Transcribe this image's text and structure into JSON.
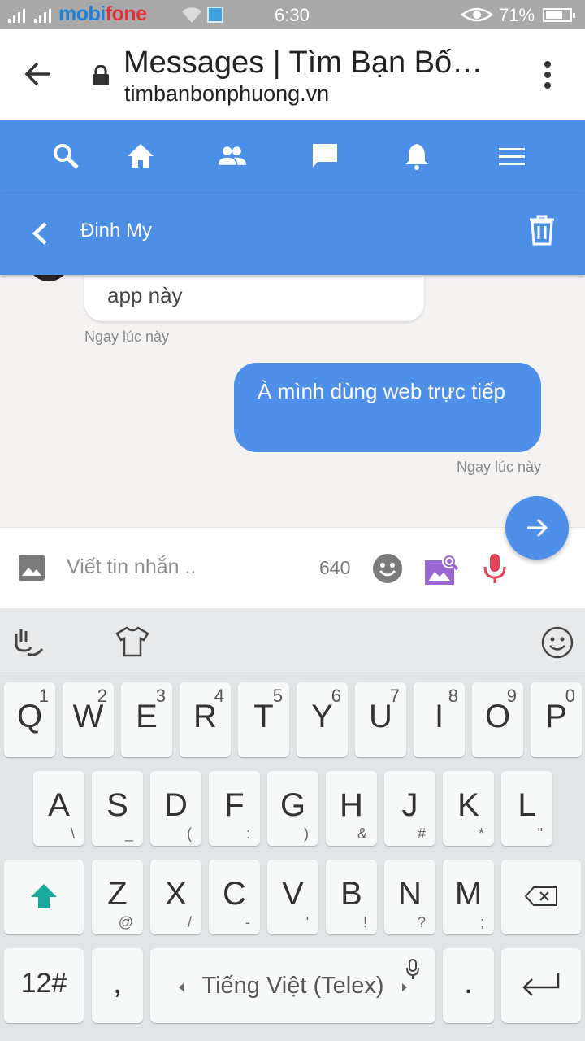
{
  "status_bar": {
    "carrier_part1": "mobi",
    "carrier_part2": "fone",
    "time": "6:30",
    "battery_percent": "71%",
    "battery_level": 0.71,
    "icons": [
      "signal-icon",
      "signal-icon",
      "wifi-icon",
      "message-notification-icon",
      "eye-icon",
      "battery-icon"
    ]
  },
  "browser": {
    "page_title": "Messages | Tìm Bạn Bốn Phương",
    "url": "timbanbonphuong.vn",
    "icons": [
      "back-arrow-icon",
      "lock-icon",
      "overflow-menu-icon"
    ]
  },
  "site_nav": {
    "items": [
      "search-icon",
      "home-icon",
      "friends-icon",
      "messages-icon",
      "notifications-icon",
      "menu-icon"
    ]
  },
  "conversation": {
    "contact_name": "Đinh My",
    "icons": [
      "chevron-left-icon",
      "trash-icon"
    ],
    "messages": [
      {
        "direction": "incoming",
        "text": "app này",
        "time": "Ngay lúc này"
      },
      {
        "direction": "outgoing",
        "text": "À mình dùng web trực tiếp",
        "time": "Ngay lúc này"
      }
    ]
  },
  "composer": {
    "placeholder": "Viết tin nhắn ..",
    "char_count": "640",
    "icons": [
      "image-icon",
      "emoji-icon",
      "photo-search-icon",
      "microphone-icon",
      "send-arrow-icon"
    ]
  },
  "keyboard": {
    "toolbar_icons": [
      "gesture-icon",
      "theme-shirt-icon",
      "emoji-icon"
    ],
    "row1": [
      {
        "main": "Q",
        "num": "1"
      },
      {
        "main": "W",
        "num": "2"
      },
      {
        "main": "E",
        "num": "3"
      },
      {
        "main": "R",
        "num": "4"
      },
      {
        "main": "T",
        "num": "5"
      },
      {
        "main": "Y",
        "num": "6"
      },
      {
        "main": "U",
        "num": "7"
      },
      {
        "main": "I",
        "num": "8"
      },
      {
        "main": "O",
        "num": "9"
      },
      {
        "main": "P",
        "num": "0"
      }
    ],
    "row2": [
      {
        "main": "A",
        "sub": "\\"
      },
      {
        "main": "S",
        "sub": "_"
      },
      {
        "main": "D",
        "sub": "("
      },
      {
        "main": "F",
        "sub": ":"
      },
      {
        "main": "G",
        "sub": ")"
      },
      {
        "main": "H",
        "sub": "&"
      },
      {
        "main": "J",
        "sub": "#"
      },
      {
        "main": "K",
        "sub": "*"
      },
      {
        "main": "L",
        "sub": "\""
      }
    ],
    "row3": [
      {
        "main": "Z",
        "sub": "@"
      },
      {
        "main": "X",
        "sub": "/"
      },
      {
        "main": "C",
        "sub": "-"
      },
      {
        "main": "V",
        "sub": "'"
      },
      {
        "main": "B",
        "sub": "!"
      },
      {
        "main": "N",
        "sub": "?"
      },
      {
        "main": "M",
        "sub": ";"
      }
    ],
    "numbers_key": "12#",
    "comma_key": ",",
    "space_label": "Tiếng Việt (Telex)",
    "period_key": ".",
    "accent_color": "#16a99c"
  }
}
